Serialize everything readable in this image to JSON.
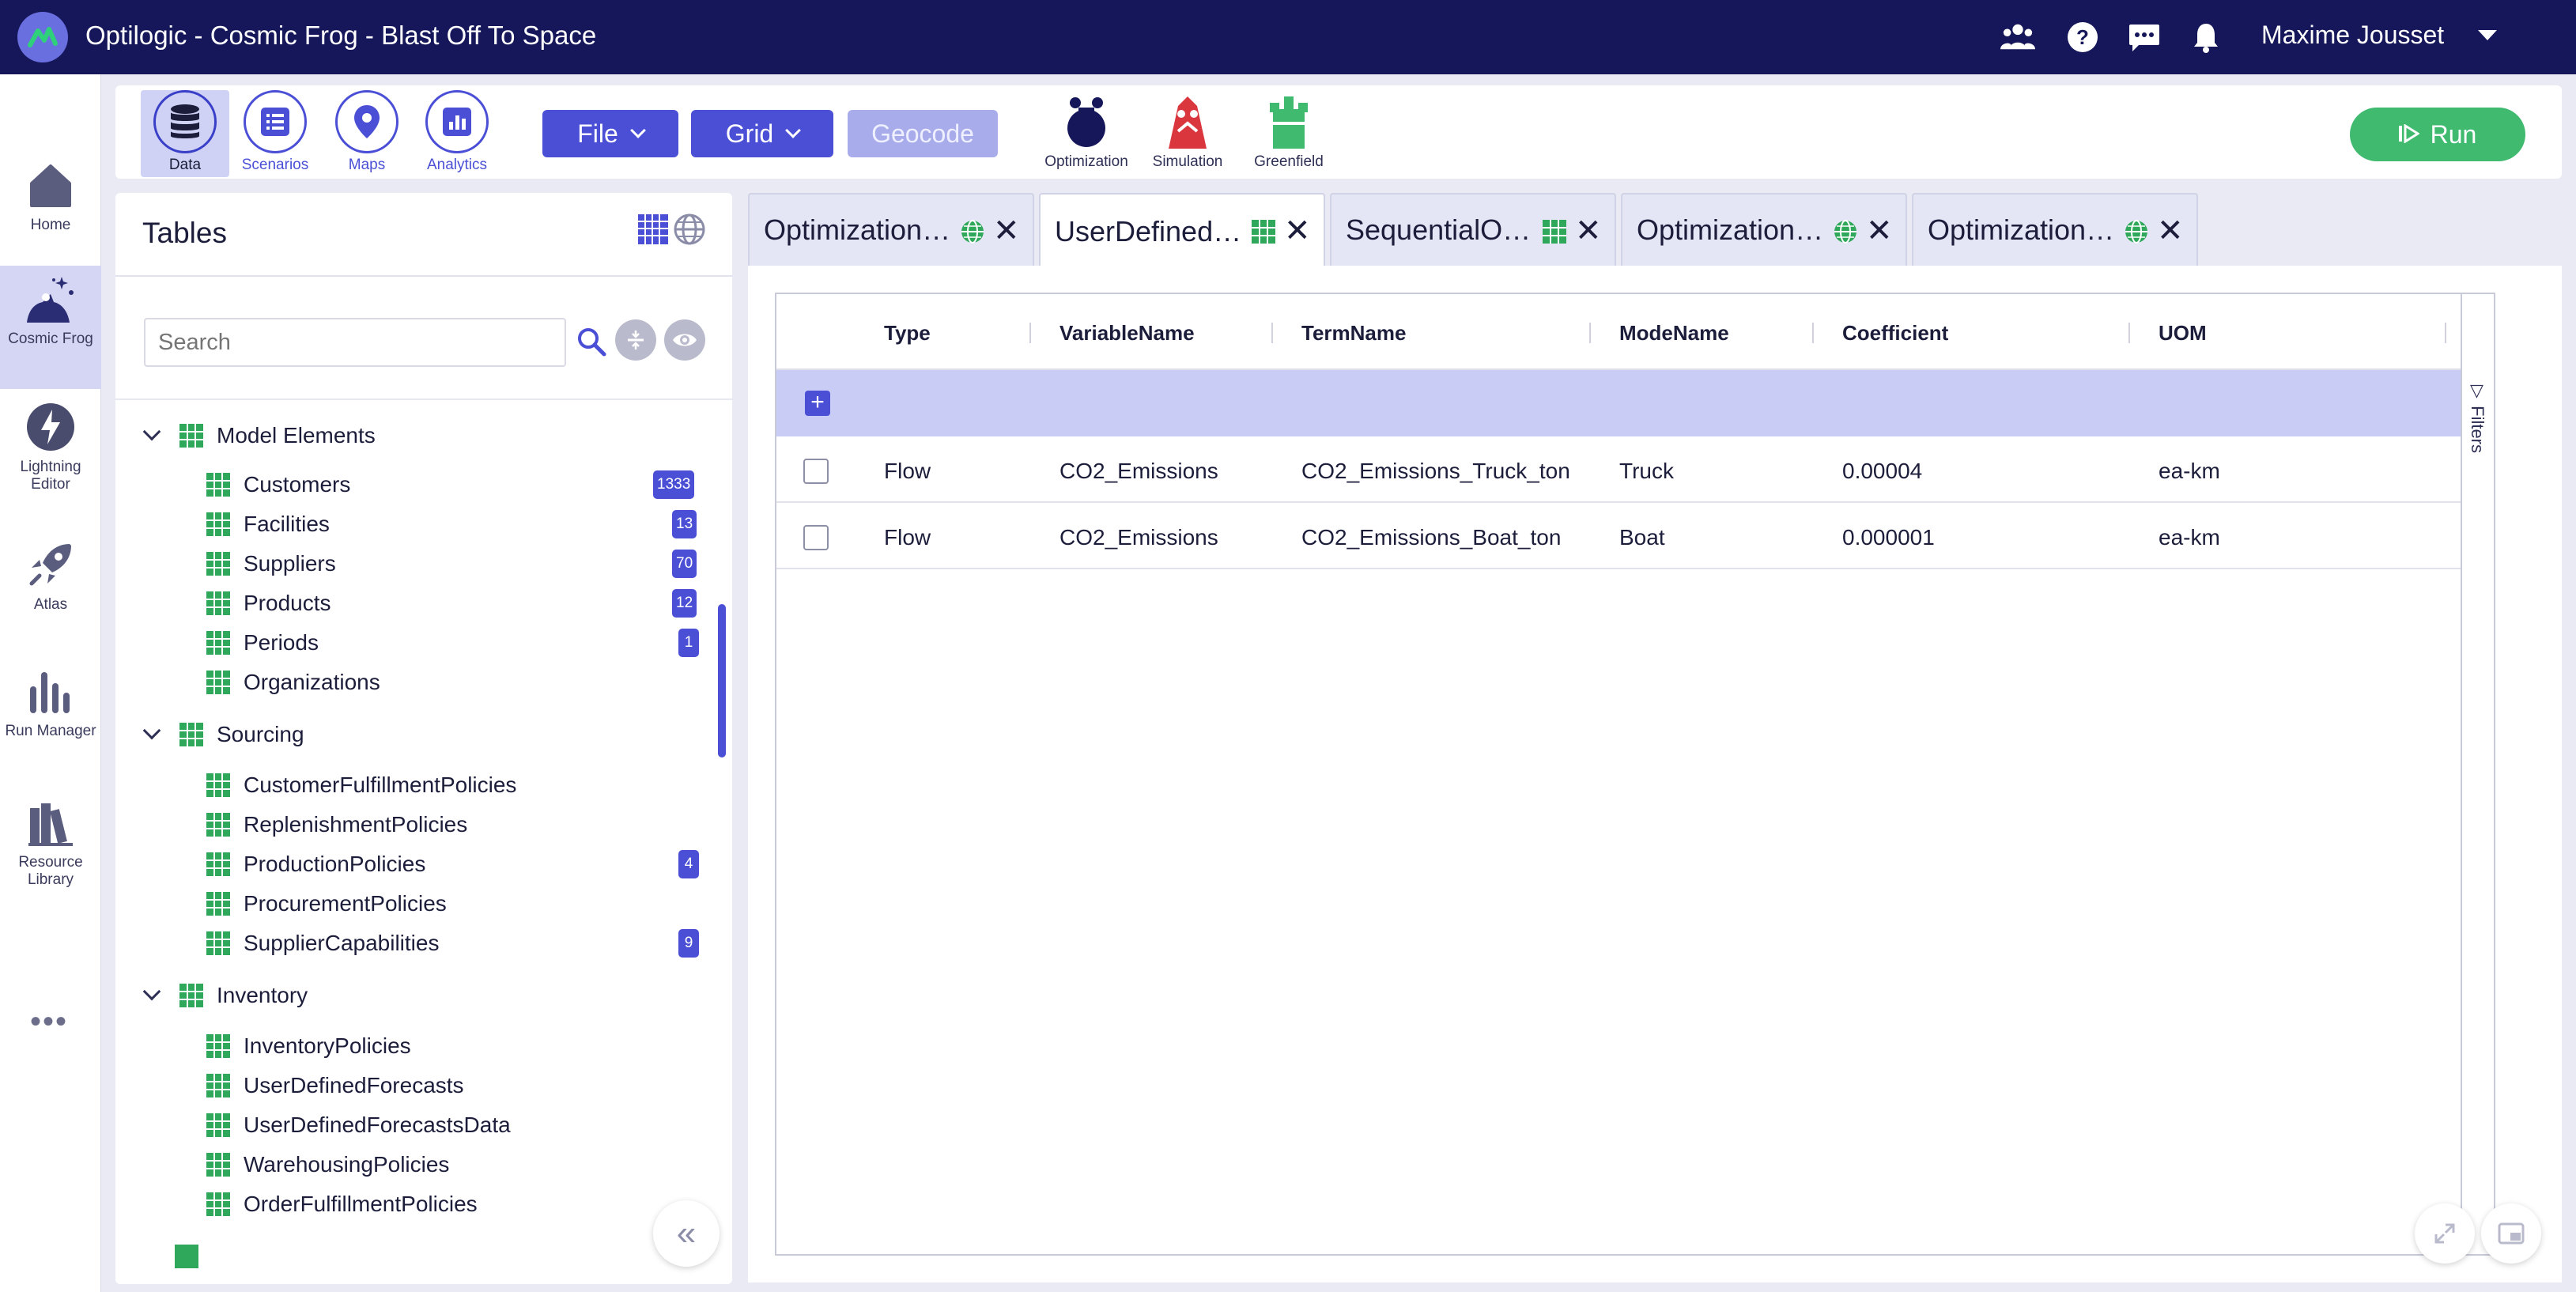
{
  "app": {
    "title": "Optilogic - Cosmic Frog - Blast Off To Space",
    "user_name": "Maxime Jousset"
  },
  "topbar_icons": [
    "team-icon",
    "help-icon",
    "chat-icon",
    "bell-icon"
  ],
  "rail": {
    "items": [
      {
        "label": "Home",
        "icon": "home-icon"
      },
      {
        "label": "Cosmic Frog",
        "icon": "cosmic-frog-icon",
        "active": true
      },
      {
        "label": "Lightning Editor",
        "icon": "lightning-editor-icon"
      },
      {
        "label": "Atlas",
        "icon": "atlas-rocket-icon"
      },
      {
        "label": "Run Manager",
        "icon": "run-manager-icon"
      },
      {
        "label": "Resource Library",
        "icon": "resource-library-icon"
      }
    ],
    "more": "•••"
  },
  "toolbar": {
    "modes": [
      {
        "label": "Data",
        "active": true
      },
      {
        "label": "Scenarios"
      },
      {
        "label": "Maps"
      },
      {
        "label": "Analytics"
      }
    ],
    "file_label": "File",
    "grid_label": "Grid",
    "geocode_label": "Geocode",
    "engines": [
      {
        "label": "Optimization"
      },
      {
        "label": "Simulation"
      },
      {
        "label": "Greenfield"
      }
    ],
    "run_label": "Run"
  },
  "tables_panel": {
    "title": "Tables",
    "search_placeholder": "Search",
    "groups": [
      {
        "name": "Model Elements",
        "items": [
          {
            "name": "Customers",
            "count": "1333"
          },
          {
            "name": "Facilities",
            "count": "13"
          },
          {
            "name": "Suppliers",
            "count": "70"
          },
          {
            "name": "Products",
            "count": "12"
          },
          {
            "name": "Periods",
            "count": "1"
          },
          {
            "name": "Organizations",
            "count": ""
          }
        ]
      },
      {
        "name": "Sourcing",
        "items": [
          {
            "name": "CustomerFulfillmentPolicies",
            "count": ""
          },
          {
            "name": "ReplenishmentPolicies",
            "count": ""
          },
          {
            "name": "ProductionPolicies",
            "count": "4"
          },
          {
            "name": "ProcurementPolicies",
            "count": ""
          },
          {
            "name": "SupplierCapabilities",
            "count": "9"
          }
        ]
      },
      {
        "name": "Inventory",
        "items": [
          {
            "name": "InventoryPolicies",
            "count": ""
          },
          {
            "name": "UserDefinedForecasts",
            "count": ""
          },
          {
            "name": "UserDefinedForecastsData",
            "count": ""
          },
          {
            "name": "WarehousingPolicies",
            "count": ""
          },
          {
            "name": "OrderFulfillmentPolicies",
            "count": ""
          }
        ]
      }
    ]
  },
  "tabs": [
    {
      "label": "Optimization…",
      "type": "globe"
    },
    {
      "label": "UserDefined…",
      "type": "grid",
      "active": true
    },
    {
      "label": "SequentialO…",
      "type": "grid"
    },
    {
      "label": "Optimization…",
      "type": "globe"
    },
    {
      "label": "Optimization…",
      "type": "globe"
    }
  ],
  "grid": {
    "columns": [
      "Type",
      "VariableName",
      "TermName",
      "ModeName",
      "Coefficient",
      "UOM"
    ],
    "rows": [
      [
        "Flow",
        "CO2_Emissions",
        "CO2_Emissions_Truck_ton",
        "Truck",
        "0.00004",
        "ea-km"
      ],
      [
        "Flow",
        "CO2_Emissions",
        "CO2_Emissions_Boat_ton",
        "Boat",
        "0.000001",
        "ea-km"
      ]
    ],
    "filters_label": "Filters"
  },
  "colors": {
    "topbar": "#16175a",
    "accent": "#4a4fd6",
    "run": "#3fba6f",
    "table_icon": "#2fa85c"
  }
}
